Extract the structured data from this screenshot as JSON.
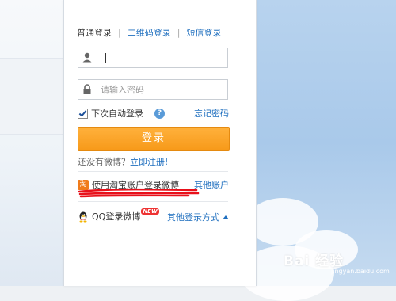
{
  "tabs": [
    {
      "label": "普通登录",
      "active": true
    },
    {
      "label": "二维码登录",
      "active": false
    },
    {
      "label": "短信登录",
      "active": false
    }
  ],
  "tab_separator": "|",
  "username": {
    "value": "",
    "icon": "user-icon"
  },
  "password": {
    "placeholder": "请输入密码",
    "icon": "lock-icon"
  },
  "remember": {
    "label": "下次自动登录",
    "checked": true
  },
  "forgot_label": "忘记密码",
  "login_button": "登录",
  "register": {
    "prompt": "还没有微博？",
    "link": "立即注册!"
  },
  "taobao": {
    "icon_text": "淘",
    "label": "使用淘宝账户登录微博",
    "other": "其他账户"
  },
  "qq": {
    "label": "QQ登录微博",
    "badge": "NEW",
    "more": "其他登录方式"
  },
  "watermark": {
    "main": "Bai 经验",
    "sub": "jingyan.baidu.com"
  },
  "colors": {
    "accent": "#1f6fbf",
    "button": "#f79a1a",
    "taobao": "#f07b1b"
  }
}
